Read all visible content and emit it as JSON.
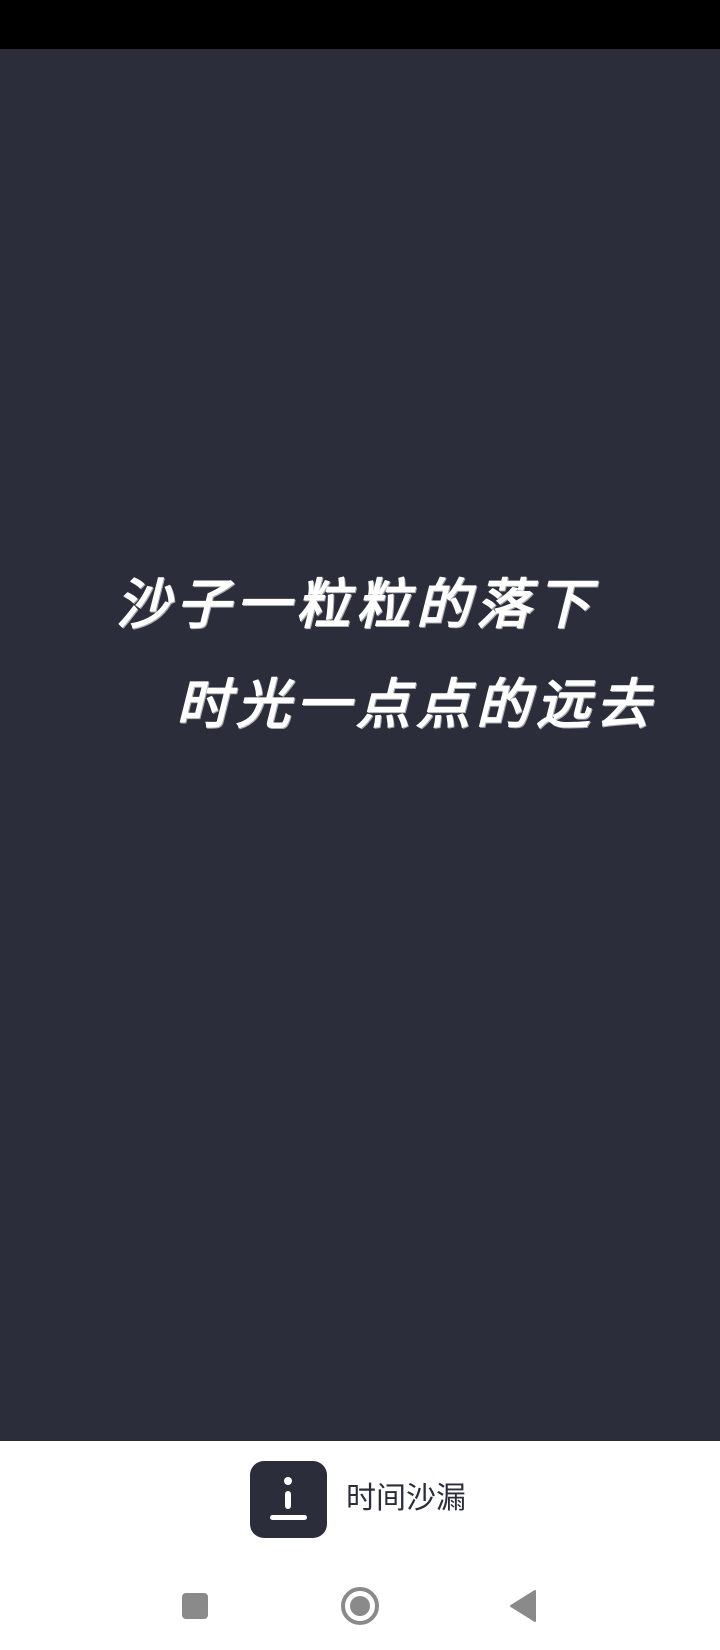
{
  "splash": {
    "line1": "沙子一粒粒的落下",
    "line2": "时光一点点的远去",
    "background_color": "#2c2d3a",
    "text_color": "#ffffff"
  },
  "brand": {
    "app_name": "时间沙漏",
    "icon": "hourglass-info-icon"
  },
  "nav": {
    "recents_icon": "square-icon",
    "home_icon": "circle-icon",
    "back_icon": "triangle-back-icon"
  }
}
